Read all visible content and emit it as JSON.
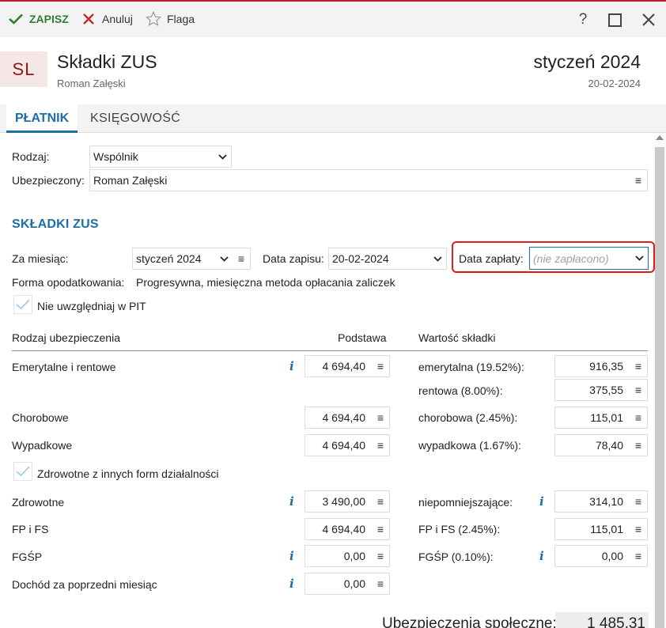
{
  "toolbar": {
    "save_label": "ZAPISZ",
    "cancel_label": "Anuluj",
    "flag_label": "Flaga",
    "help_glyph": "?",
    "maximize_glyph": "☐",
    "close_glyph": "✕"
  },
  "header": {
    "initials": "SL",
    "title": "Składki ZUS",
    "person": "Roman Załęski",
    "month": "styczeń 2024",
    "date": "20-02-2024"
  },
  "tabs": [
    {
      "label": "PŁATNIK"
    },
    {
      "label": "KSIĘGOWOŚĆ"
    }
  ],
  "payer": {
    "type_label": "Rodzaj:",
    "type_value": "Wspólnik",
    "insured_label": "Ubezpieczony:",
    "insured_value": "Roman Załęski"
  },
  "section_title": "SKŁADKI ZUS",
  "period": {
    "month_label": "Za miesiąc:",
    "month_value": "styczeń 2024",
    "entry_date_label": "Data zapisu:",
    "entry_date_value": "20-02-2024",
    "payment_date_label": "Data zapłaty:",
    "payment_date_placeholder": "(nie zapłacono)"
  },
  "taxation": {
    "label": "Forma opodatkowania:",
    "value": "Progresywna, miesięczna metoda opłacania zaliczek"
  },
  "exclude_pit": {
    "label": "Nie uwzględniaj w PIT",
    "checked": true
  },
  "table_headers": {
    "type": "Rodzaj ubezpieczenia",
    "base": "Podstawa",
    "value": "Wartość składki"
  },
  "rows": {
    "pension": {
      "label": "Emerytalne i rentowe",
      "base": "4 694,40",
      "sub1_label": "emerytalna (19.52%):",
      "sub1_value": "916,35",
      "sub2_label": "rentowa (8.00%):",
      "sub2_value": "375,55"
    },
    "sickness": {
      "label": "Chorobowe",
      "base": "4 694,40",
      "sub_label": "chorobowa (2.45%):",
      "sub_value": "115,01"
    },
    "accident": {
      "label": "Wypadkowe",
      "base": "4 694,40",
      "sub_label": "wypadkowa (1.67%):",
      "sub_value": "78,40"
    },
    "health_other": {
      "label": "Zdrowotne z innych form działalności",
      "checked": true
    },
    "health": {
      "label": "Zdrowotne",
      "base": "3 490,00",
      "sub_label": "niepomniejszające:",
      "sub_value": "314,10"
    },
    "fpfs": {
      "label": "FP i FS",
      "base": "4 694,40",
      "sub_label": "FP i FS (2.45%):",
      "sub_value": "115,01"
    },
    "fgsp": {
      "label": "FGŚP",
      "base": "0,00",
      "sub_label": "FGŚP (0.10%):",
      "sub_value": "0,00"
    },
    "prev_income": {
      "label": "Dochód za poprzedni miesiąc",
      "base": "0,00"
    }
  },
  "summary": {
    "label": "Ubezpieczenia społeczne:",
    "value": "1 485,31"
  },
  "colors": {
    "accent": "#1b6fa6",
    "save": "#2e7d32",
    "brand": "#b9222a",
    "focus": "#e01b1b"
  }
}
